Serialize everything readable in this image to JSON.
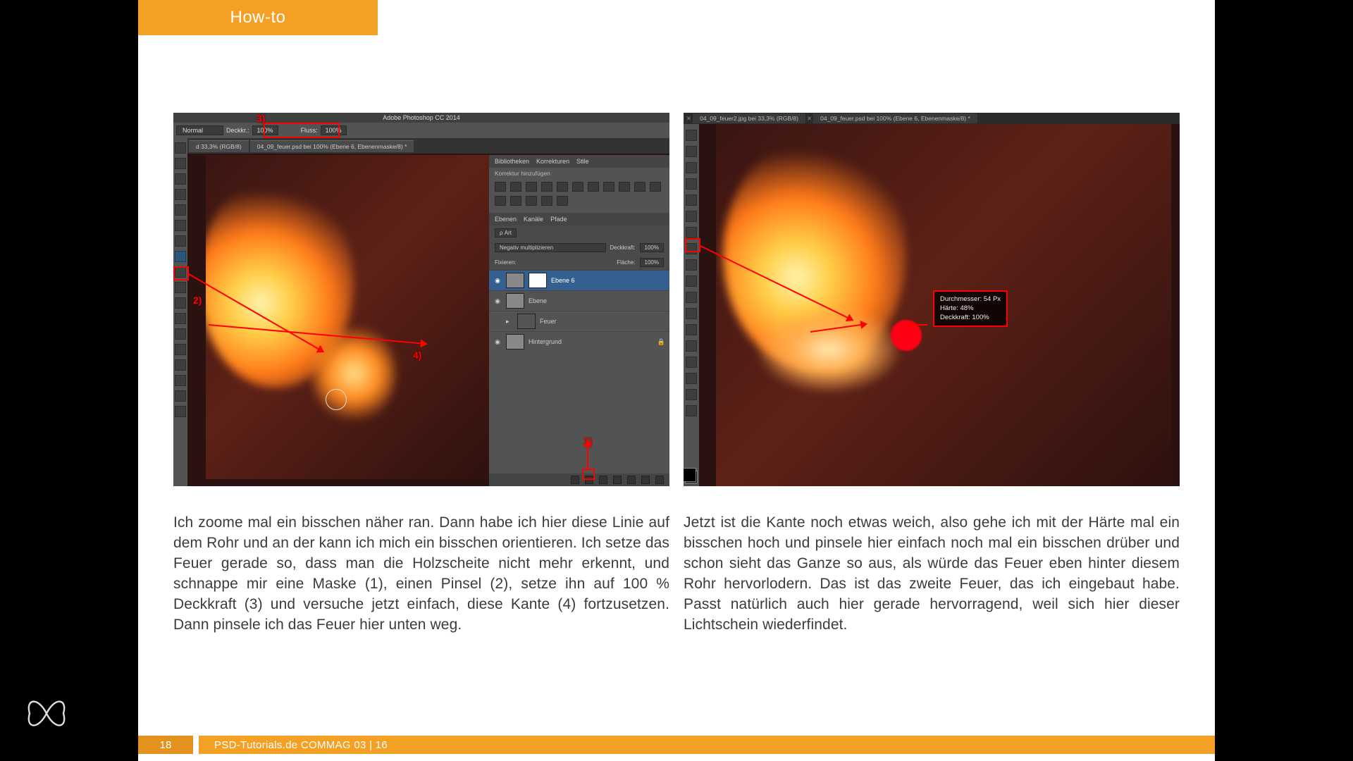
{
  "header": {
    "tab_label": "How-to"
  },
  "footer": {
    "page_number": "18",
    "credit": "PSD-Tutorials.de   COMMAG 03 | 16"
  },
  "left": {
    "ps_title": "Adobe Photoshop CC 2014",
    "blend_mode": "Normal",
    "opacity_label": "Deckkr.:",
    "opacity_value": "100%",
    "flow_label": "Fluss:",
    "flow_value": "100%",
    "doc_tab1": "d 33,3% (RGB/8)",
    "doc_tab2": "04_09_feuer.psd bei 100% (Ebene 6, Ebenenmaske/8) *",
    "adj_tab1": "Bibliotheken",
    "adj_tab2": "Korrekturen",
    "adj_tab3": "Stile",
    "adj_sub": "Korrektur hinzufügen",
    "layers_tab1": "Ebenen",
    "layers_tab2": "Kanäle",
    "layers_tab3": "Pfade",
    "layers_kind": "ρ Art",
    "layer_blend": "Negativ multiplizieren",
    "layer_opacity_label": "Deckkraft:",
    "layer_opacity_value": "100%",
    "lock_label": "Fixieren:",
    "fill_label": "Fläche:",
    "fill_value": "100%",
    "layer1": "Ebene 6",
    "layer2": "Ebene",
    "layer3": "Feuer",
    "layer4": "Hintergrund",
    "marker1": "1)",
    "marker2": "2)",
    "marker3": "3)",
    "marker4": "4)",
    "caption": "Ich zoome mal ein bisschen näher ran. Dann habe ich hier diese Linie auf dem Rohr und an der kann ich mich ein bisschen orientieren. Ich setze das Feuer gerade so, dass man die Holzscheite nicht mehr erkennt, und schnappe mir eine Maske (1), einen Pinsel (2), setze ihn auf 100 % Deckkraft (3) und versuche jetzt einfach, diese Kante (4) fortzusetzen. Dann pinsele ich das Feuer hier unten weg."
  },
  "right": {
    "doc_tab1": "04_09_feuer2.jpg bei 33,3% (RGB/8)",
    "doc_tab2": "04_09_feuer.psd bei 100% (Ebene 6, Ebenenmaske/8) *",
    "hud_line1": "Durchmesser: 54 Px",
    "hud_line2": "Härte: 48%",
    "hud_line3": "Deckkraft: 100%",
    "caption": "Jetzt ist die Kante noch etwas weich, also gehe ich mit der Härte mal ein bisschen hoch und pinsele hier einfach noch mal ein bisschen drüber und schon sieht das Ganze so aus, als würde das Feuer eben hinter diesem Rohr hervorlodern. Das ist das zweite Feuer, das ich eingebaut habe. Passt natürlich auch hier gerade hervor­ragend, weil sich hier dieser Lichtschein wiederfindet."
  }
}
